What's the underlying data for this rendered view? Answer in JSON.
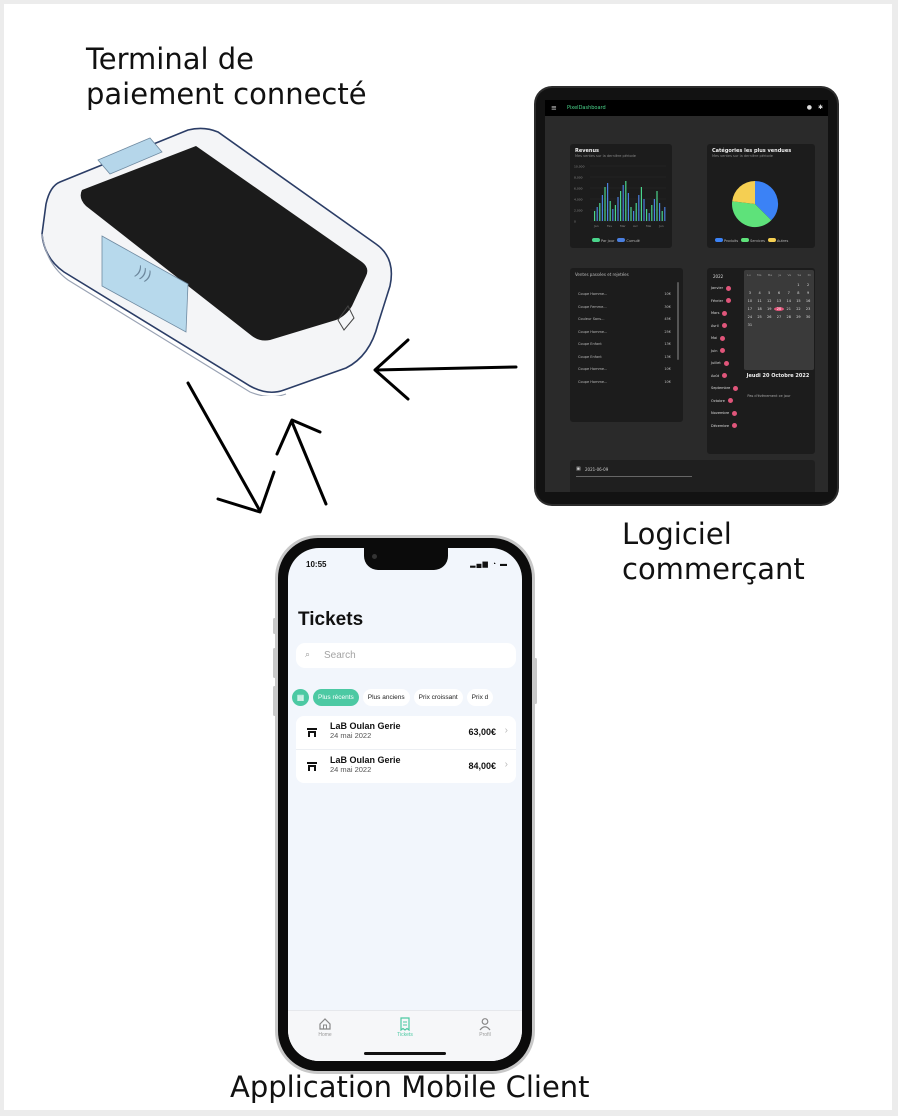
{
  "captions": {
    "terminal_line1": "Terminal de",
    "terminal_line2": "paiement connecté",
    "logiciel_line1": "Logiciel",
    "logiciel_line2": "commerçant",
    "app": "Application Mobile Client"
  },
  "colors": {
    "accent_green": "#4cc9a3",
    "tablet_bg": "#2a2a2a",
    "bar_green": "#4ad48b",
    "bar_blue": "#4a7fe0",
    "pie_blue": "#3b82f6",
    "pie_green": "#5ee27a",
    "pie_yellow": "#f5cf52",
    "calendar_pink": "#e0557a"
  },
  "tablet": {
    "brand": "PixelDashboard",
    "revenus": {
      "title": "Revenus",
      "subtitle": "Mes ventes sur la dernière période",
      "y_ticks": [
        "10,000",
        "8,000",
        "6,000",
        "4,000",
        "2,000",
        "0"
      ],
      "x_ticks": [
        "Jan",
        "Fev",
        "Mar",
        "Avr",
        "Mai",
        "Jun"
      ],
      "legend": [
        "Par jour",
        "Cumulé"
      ]
    },
    "categories": {
      "title": "Catégories les plus vendues",
      "subtitle": "Mes ventes sur la dernière période",
      "legend": [
        "Produits",
        "Services",
        "Autres"
      ]
    },
    "ventes": {
      "title": "Ventes passées et rejetées",
      "rows": [
        {
          "name": "Coupe Homme...",
          "amount": "10€"
        },
        {
          "name": "Coupe Femme...",
          "amount": "30€"
        },
        {
          "name": "Couleur Sans...",
          "amount": "45€"
        },
        {
          "name": "Coupe Homme...",
          "amount": "25€"
        },
        {
          "name": "Coupe Enfant",
          "amount": "13€"
        },
        {
          "name": "Coupe Enfant",
          "amount": "13€"
        },
        {
          "name": "Coupe Homme...",
          "amount": "10€"
        },
        {
          "name": "Coupe Homme...",
          "amount": "10€"
        }
      ]
    },
    "calendar": {
      "year": "2022",
      "months": [
        "Janvier",
        "Février",
        "Mars",
        "Avril",
        "Mai",
        "Juin",
        "Juillet",
        "Août",
        "Septembre",
        "Octobre",
        "Novembre",
        "Décembre"
      ],
      "weekdays": [
        "Lu",
        "Ma",
        "Me",
        "Je",
        "Ve",
        "Sa",
        "Di"
      ],
      "days": [
        "",
        "",
        "",
        "",
        "",
        "1",
        "2",
        "3",
        "4",
        "5",
        "6",
        "7",
        "8",
        "9",
        "10",
        "11",
        "12",
        "13",
        "14",
        "15",
        "16",
        "17",
        "18",
        "19",
        "20",
        "21",
        "22",
        "23",
        "24",
        "25",
        "26",
        "27",
        "28",
        "29",
        "30",
        "31"
      ],
      "selected_day": "20",
      "date_title": "Jeudi 20 Octobre 2022",
      "no_event": "Pas d'évènement ce jour"
    },
    "bottom_date": "2021-06-09"
  },
  "phone": {
    "time": "10:55",
    "status": "▂▄▆ ◔ ▬",
    "title": "Tickets",
    "search_placeholder": "Search",
    "chips": [
      "Plus récents",
      "Plus anciens",
      "Prix croissant",
      "Prix d"
    ],
    "tickets": [
      {
        "name": "LaB Oulan Gerie",
        "date": "24 mai 2022",
        "amount": "63,00€"
      },
      {
        "name": "LaB Oulan Gerie",
        "date": "24 mai 2022",
        "amount": "84,00€"
      }
    ],
    "tabs": [
      "Home",
      "Tickets",
      "Profil"
    ]
  }
}
